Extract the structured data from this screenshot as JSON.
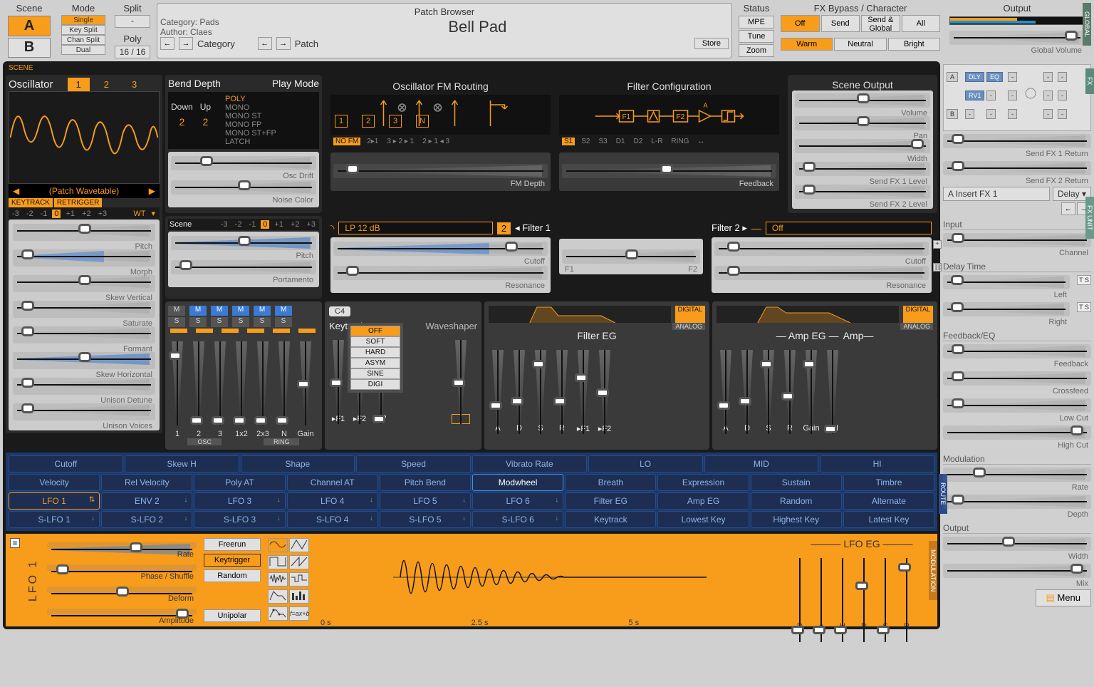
{
  "top": {
    "scene_label": "Scene",
    "scene_a": "A",
    "scene_b": "B",
    "mode_label": "Mode",
    "modes": [
      "Single",
      "Key Split",
      "Chan Split",
      "Dual"
    ],
    "split_label": "Split",
    "split_value": "-",
    "poly_label": "Poly",
    "poly_value": "16 / 16"
  },
  "patch": {
    "title": "Patch Browser",
    "category_label": "Category: ",
    "category_value": "Pads",
    "author_label": "Author: ",
    "author_value": "Claes",
    "name": "Bell Pad",
    "nav_category": "Category",
    "nav_patch": "Patch",
    "store": "Store"
  },
  "status": {
    "label": "Status",
    "mpe": "MPE",
    "tune": "Tune",
    "zoom": "Zoom"
  },
  "fxbypass": {
    "label": "FX Bypass / Character",
    "off": "Off",
    "send": "Send",
    "sendglobal": "Send & Global",
    "all": "All",
    "warm": "Warm",
    "neutral": "Neutral",
    "bright": "Bright"
  },
  "output": {
    "label": "Output",
    "global_volume": "Global Volume"
  },
  "osc": {
    "label": "Oscillator",
    "tabs": [
      "1",
      "2",
      "3"
    ],
    "wavetable": "(Patch Wavetable)",
    "keytrack": "KEYTRACK",
    "retrigger": "RETRIGGER",
    "pitch_offsets": [
      "-3",
      "-2",
      "-1",
      "0",
      "+1",
      "+2",
      "+3"
    ],
    "wt": "WT",
    "params": [
      "Pitch",
      "Morph",
      "Skew Vertical",
      "Saturate",
      "Formant",
      "Skew Horizontal",
      "Unison Detune",
      "Unison Voices"
    ]
  },
  "bend": {
    "depth_label": "Bend Depth",
    "playmode_label": "Play Mode",
    "down": "Down",
    "up": "Up",
    "down_val": "2",
    "up_val": "2",
    "modes": [
      "POLY",
      "MONO",
      "MONO ST",
      "MONO FP",
      "MONO ST+FP",
      "LATCH"
    ],
    "oscdrift": "Osc Drift",
    "noisecolor": "Noise Color"
  },
  "fmrouting": {
    "title": "Oscillator FM Routing",
    "nodes": [
      "1",
      "2",
      "3",
      "N"
    ],
    "labels": [
      "NO FM",
      "2▸1",
      "3 ▸ 2 ▸ 1",
      "2 ▸ 1 ◂ 3"
    ]
  },
  "filterconfig": {
    "title": "Filter Configuration",
    "f1": "F1",
    "f2": "F2",
    "a": "A",
    "labels": [
      "S1",
      "S2",
      "S3",
      "D1",
      "D2",
      "L-R",
      "RING",
      "↔"
    ],
    "fmdepth": "FM Depth",
    "feedback": "Feedback"
  },
  "sceneout": {
    "title": "Scene Output",
    "volume": "Volume",
    "pan": "Pan",
    "width": "Width",
    "sendfx1": "Send FX 1 Level",
    "sendfx2": "Send FX 2 Level"
  },
  "scenepitch": {
    "label": "Scene",
    "offsets": [
      "-3",
      "-2",
      "-1",
      "0",
      "+1",
      "+2",
      "+3"
    ],
    "pitch": "Pitch",
    "portamento": "Portamento"
  },
  "filter1": {
    "type": "LP 12 dB",
    "num": "2",
    "label": "◂ Filter 1",
    "cutoff": "Cutoff",
    "resonance": "Resonance"
  },
  "filterbalance": {
    "f1": "F1",
    "f2": "F2"
  },
  "filter2": {
    "label": "Filter 2 ▸",
    "type": "Off",
    "cutoff": "Cutoff",
    "resonance": "Resonance",
    "plus": "+"
  },
  "mixer": {
    "m": "M",
    "s": "S",
    "labels": [
      "1",
      "2",
      "3",
      "1x2",
      "2x3",
      "N",
      "Gain"
    ],
    "osc": "OSC",
    "ring": "RING"
  },
  "keytrack": {
    "note": "C4",
    "label": "Keytrack",
    "ws_label": "Waveshaper",
    "ws_items": [
      "OFF",
      "SOFT",
      "HARD",
      "ASYM",
      "SINE",
      "DIGI"
    ],
    "cols": [
      "▸F1",
      "▸F2",
      "HP"
    ]
  },
  "filtereg": {
    "title": "Filter EG",
    "digital": "DIGITAL",
    "analog": "ANALOG",
    "cols": [
      "A",
      "D",
      "S",
      "R",
      "▸F1",
      "▸F2"
    ]
  },
  "ampeg": {
    "title": "Amp EG",
    "amp": "Amp",
    "digital": "DIGITAL",
    "analog": "ANALOG",
    "cols": [
      "A",
      "D",
      "S",
      "R",
      "Gain",
      "Vel"
    ]
  },
  "modmatrix": {
    "row1": [
      "Cutoff",
      "Skew H",
      "Shape",
      "Speed",
      "Vibrato Rate",
      "LO",
      "MID",
      "HI"
    ],
    "row2": [
      "Velocity",
      "Rel Velocity",
      "Poly AT",
      "Channel AT",
      "Pitch Bend",
      "Modwheel",
      "Breath",
      "Expression",
      "Sustain",
      "Timbre"
    ],
    "row3": [
      "LFO 1",
      "ENV 2",
      "LFO 3",
      "LFO 4",
      "LFO 5",
      "LFO 6",
      "Filter EG",
      "Amp EG",
      "Random",
      "Alternate"
    ],
    "row4": [
      "S-LFO 1",
      "S-LFO 2",
      "S-LFO 3",
      "S-LFO 4",
      "S-LFO 5",
      "S-LFO 6",
      "Keytrack",
      "Lowest Key",
      "Highest Key",
      "Latest Key"
    ]
  },
  "lfo": {
    "name": "LFO 1",
    "params": [
      "Rate",
      "Phase / Shuffle",
      "Deform",
      "Amplitude"
    ],
    "modes": [
      "Freerun",
      "Keytrigger",
      "Random"
    ],
    "unipolar": "Unipolar",
    "timemarks": [
      "0 s",
      "2.5 s",
      "5 s"
    ],
    "eg_title": "LFO EG",
    "eg_cols": [
      "D",
      "A",
      "H",
      "D",
      "S",
      "R"
    ]
  },
  "right": {
    "sendfx1": "Send FX 1 Return",
    "sendfx2": "Send FX 2 Return",
    "fxunit": "A Insert FX 1",
    "fxtype": "Delay ▾",
    "nav_prev": "←",
    "nav_next": "→",
    "input": "Input",
    "channel": "Channel",
    "delaytime": "Delay Time",
    "left": "Left",
    "right_l": "Right",
    "ts": "T S",
    "feedbackeq": "Feedback/EQ",
    "feedback": "Feedback",
    "crossfeed": "Crossfeed",
    "lowcut": "Low Cut",
    "highcut": "High Cut",
    "modulation": "Modulation",
    "rate": "Rate",
    "depth": "Depth",
    "output": "Output",
    "width": "Width",
    "mix": "Mix",
    "menu": "Menu"
  },
  "fxdiagram": {
    "a": "A",
    "b": "B",
    "dly": "DLY",
    "eq": "EQ",
    "rv1": "RV1"
  },
  "side_tabs": {
    "global": "GLOBAL",
    "fx": "FX",
    "fxunit": "FX UNIT",
    "scene": "SCENE",
    "route": "ROUTE",
    "modulation": "MODULATION"
  }
}
